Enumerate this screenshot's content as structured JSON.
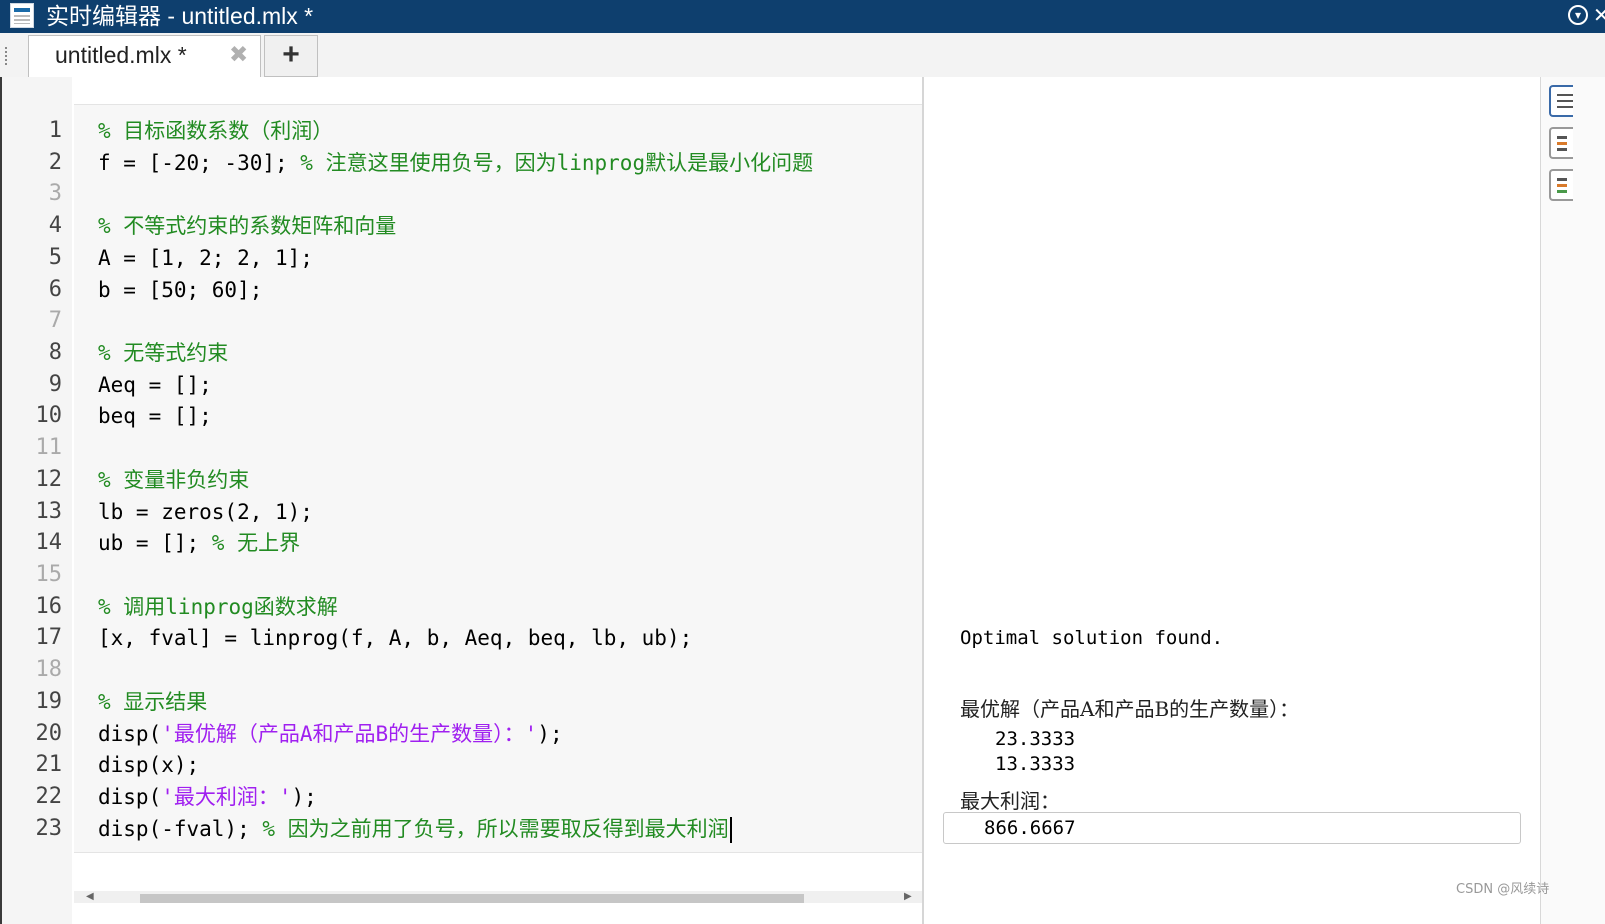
{
  "window": {
    "title": "实时编辑器 - untitled.mlx *"
  },
  "tabs": [
    {
      "label": "untitled.mlx *",
      "close_glyph": "✖"
    }
  ],
  "add_tab_glyph": "+",
  "line_numbers": [
    "1",
    "2",
    "3",
    "4",
    "5",
    "6",
    "7",
    "8",
    "9",
    "10",
    "11",
    "12",
    "13",
    "14",
    "15",
    "16",
    "17",
    "18",
    "19",
    "20",
    "21",
    "22",
    "23"
  ],
  "code_lines": {
    "l1": {
      "comment": "% 目标函数系数（利润）"
    },
    "l2": {
      "code": "f = [-20; -30]; ",
      "comment": "% 注意这里使用负号，因为linprog默认是最小化问题"
    },
    "l4": {
      "comment": "% 不等式约束的系数矩阵和向量"
    },
    "l5": {
      "code": "A = [1, 2; 2, 1];"
    },
    "l6": {
      "code": "b = [50; 60];"
    },
    "l8": {
      "comment": "% 无等式约束"
    },
    "l9": {
      "code": "Aeq = [];"
    },
    "l10": {
      "code": "beq = [];"
    },
    "l12": {
      "comment": "% 变量非负约束"
    },
    "l13": {
      "code": "lb = zeros(2, 1);"
    },
    "l14": {
      "code": "ub = []; ",
      "comment": "% 无上界"
    },
    "l16": {
      "comment": "% 调用linprog函数求解"
    },
    "l17": {
      "code": "[x, fval] = linprog(f, A, b, Aeq, beq, lb, ub);"
    },
    "l19": {
      "comment": "% 显示结果"
    },
    "l20": {
      "pre": "disp(",
      "str": "'最优解（产品A和产品B的生产数量）：'",
      "post": ");"
    },
    "l21": {
      "code": "disp(x);"
    },
    "l22": {
      "pre": "disp(",
      "str": "'最大利润：'",
      "post": ");"
    },
    "l23": {
      "code": "disp(-fval); ",
      "comment": "% 因为之前用了负号，所以需要取反得到最大利润"
    }
  },
  "output": {
    "status": "Optimal solution found.",
    "label_solution": "最优解（产品A和产品B的生产数量）：",
    "x1": "23.3333",
    "x2": "13.3333",
    "label_profit": "最大利润：",
    "profit": "866.6667"
  },
  "watermark": "CSDN @风续诗",
  "colors": {
    "titlebar": "#0e3f6e",
    "comment": "#228b22",
    "string": "#a020f0"
  },
  "icons": [
    "live-editor-app-icon",
    "collapse-icon",
    "close-tab-icon",
    "add-tab-icon",
    "output-inline-icon",
    "output-right-icon",
    "hide-code-icon"
  ]
}
